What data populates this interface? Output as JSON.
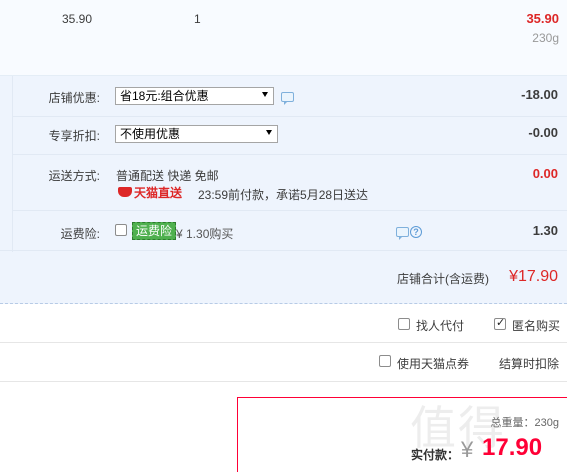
{
  "item": {
    "price": "35.90",
    "quantity": "1",
    "subtotal": "35.90",
    "weight": "230g"
  },
  "shop_discount": {
    "label": "店铺优惠:",
    "selected": "省18元:组合优惠",
    "amount": "-18.00"
  },
  "exclusive_discount": {
    "label": "专享折扣:",
    "selected": "不使用优惠",
    "amount": "-0.00"
  },
  "shipping": {
    "label": "运送方式:",
    "method": "普通配送 快递 免邮",
    "tmall_label": "天猫直送",
    "promise": "23:59前付款，承诺5月28日送达",
    "amount": "0.00"
  },
  "insurance": {
    "label": "运费险:",
    "tag": "运费险",
    "price_text": "¥ 1.30购买",
    "amount": "1.30"
  },
  "shop_total": {
    "label": "店铺合计(含运费)",
    "value": "¥17.90"
  },
  "options": {
    "proxy_pay": "找人代付",
    "anonymous": "匿名购买",
    "anonymous_checked": true,
    "proxy_checked": false,
    "use_points": "使用天猫点券",
    "deduct_at_checkout": "结算时扣除"
  },
  "summary": {
    "total_weight": "总重量：230g",
    "pay_label": "实付款：",
    "currency": "¥",
    "pay_value": "17.90"
  },
  "watermark": "值得",
  "colors": {
    "price_red": "#dd2727",
    "pay_red": "#ff0036",
    "panel_bg": "#eef4fd"
  }
}
